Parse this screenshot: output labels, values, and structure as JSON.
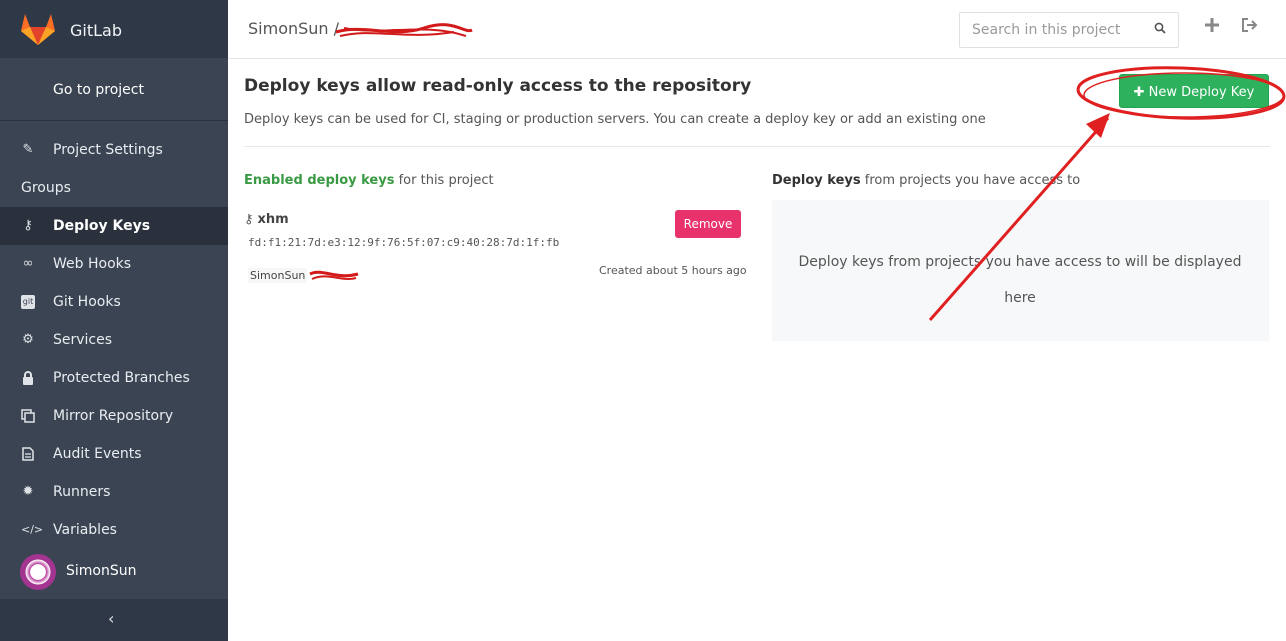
{
  "sidebar": {
    "brand": "GitLab",
    "go_to_project": "Go to project",
    "items": [
      {
        "label": "Project Settings",
        "icon": "edit-icon"
      },
      {
        "label": "Groups",
        "icon": ""
      },
      {
        "label": "Deploy Keys",
        "icon": "key-icon",
        "active": true
      },
      {
        "label": "Web Hooks",
        "icon": "link-icon"
      },
      {
        "label": "Git Hooks",
        "icon": "git-icon"
      },
      {
        "label": "Services",
        "icon": "cogs-icon"
      },
      {
        "label": "Protected Branches",
        "icon": "lock-icon"
      },
      {
        "label": "Mirror Repository",
        "icon": "clone-icon"
      },
      {
        "label": "Audit Events",
        "icon": "file-icon"
      },
      {
        "label": "Runners",
        "icon": "gear-icon"
      },
      {
        "label": "Variables",
        "icon": "code-icon"
      }
    ],
    "user": "SimonSun",
    "collapse_icon": "chevron-left-icon"
  },
  "header": {
    "breadcrumb_owner": "SimonSun",
    "breadcrumb_sep": "/",
    "search_placeholder": "Search in this project"
  },
  "main": {
    "title": "Deploy keys allow read-only access to the repository",
    "subtitle": "Deploy keys can be used for CI, staging or production servers. You can create a deploy key or add an existing one",
    "new_button": "New Deploy Key",
    "enabled_label": "Enabled deploy keys",
    "enabled_suffix": " for this project",
    "key": {
      "name": "xhm",
      "fingerprint": "fd:f1:21:7d:e3:12:9f:76:5f:07:c9:40:28:7d:1f:fb",
      "owner": "SimonSun",
      "created": "Created about 5 hours ago",
      "remove_label": "Remove"
    },
    "access_label": "Deploy keys",
    "access_suffix": " from projects you have access to",
    "empty_line1": "Deploy keys from projects you have access to will be displayed",
    "empty_line2": "here"
  },
  "colors": {
    "sidebar_bg": "#3b4452",
    "new_button": "#2eb15c",
    "remove_button": "#e8326b",
    "annotation": "#e02020"
  }
}
